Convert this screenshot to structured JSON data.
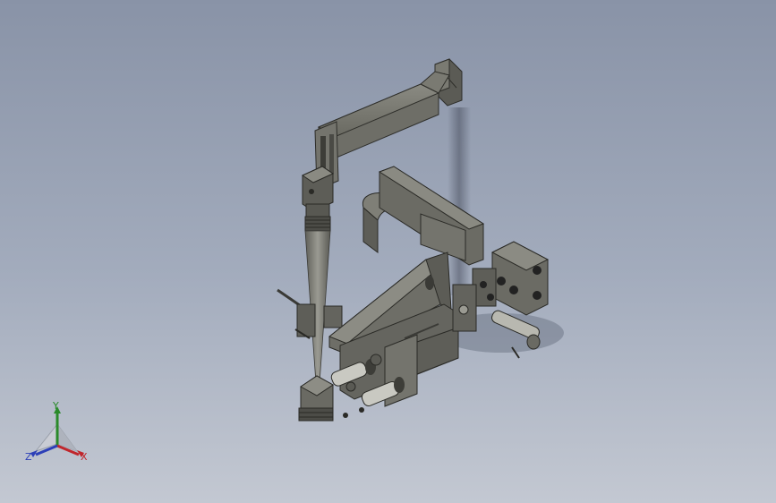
{
  "viewport": {
    "background_top": "#8993a7",
    "background_bottom": "#c3c8d2",
    "model_color": "#6d6d66"
  },
  "triad": {
    "x_label": "X",
    "y_label": "Y",
    "z_label": "Z",
    "x_color": "#c0262c",
    "y_color": "#2a8a2a",
    "z_color": "#2c3fb8"
  }
}
